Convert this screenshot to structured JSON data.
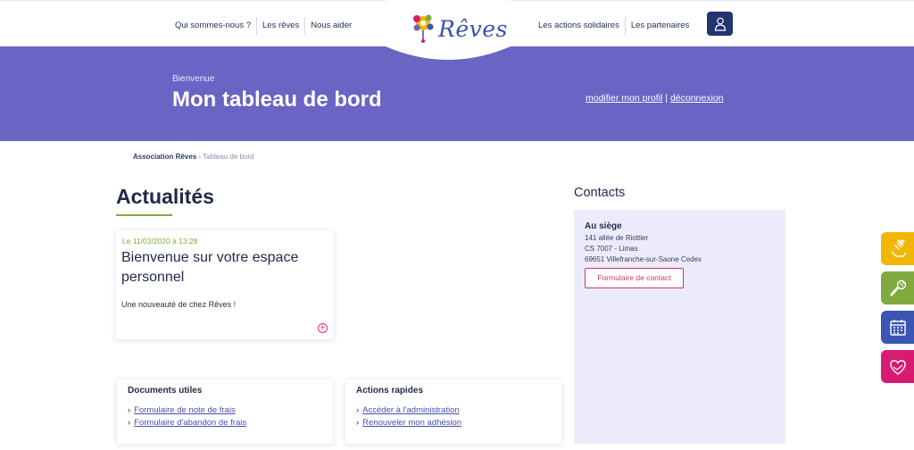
{
  "nav": {
    "left": [
      "Qui sommes-nous ?",
      "Les rêves",
      "Nous aider"
    ],
    "right": [
      "Les actions solidaires",
      "Les partenaires"
    ]
  },
  "logo": {
    "text": "Rêves"
  },
  "hero": {
    "welcome": "Bienvenue",
    "title": "Mon tableau de bord",
    "edit_profile": "modifier mon profil",
    "separator": "|",
    "logout": "déconnexion"
  },
  "breadcrumb": {
    "root": "Association Rêves",
    "sep": "›",
    "current": "Tableau de bord"
  },
  "news": {
    "section_title": "Actualités",
    "items": [
      {
        "date": "Le 11/03/2020 à 13:28",
        "title": "Bienvenue sur votre espace personnel",
        "text": "Une nouveauté de chez Rêves !"
      }
    ]
  },
  "documents": {
    "title": "Documents utiles",
    "links": [
      "Formulaire de note de frais",
      "Formulaire d'abandon de frais"
    ]
  },
  "actions": {
    "title": "Actions rapides",
    "links": [
      "Accéder à l'administration",
      "Renouveler mon adhésion"
    ]
  },
  "contacts": {
    "title": "Contacts",
    "hq_title": "Au siège",
    "address": [
      "141 allée de Riottier",
      "CS 7007 - Limas",
      "69651 Villefranche-sur-Saone Cedex"
    ],
    "button": "Formulaire de contact"
  },
  "side_tabs": [
    {
      "icon": "hands-heart-icon",
      "color": "#f2b705"
    },
    {
      "icon": "microphone-icon",
      "color": "#7faa3d"
    },
    {
      "icon": "calendar-icon",
      "color": "#3a55b4"
    },
    {
      "icon": "handshake-icon",
      "color": "#d81b72"
    }
  ],
  "colors": {
    "hero": "#6a64c5",
    "accent_green": "#7faa3d",
    "accent_pink": "#d8336b",
    "navy": "#22356e"
  }
}
